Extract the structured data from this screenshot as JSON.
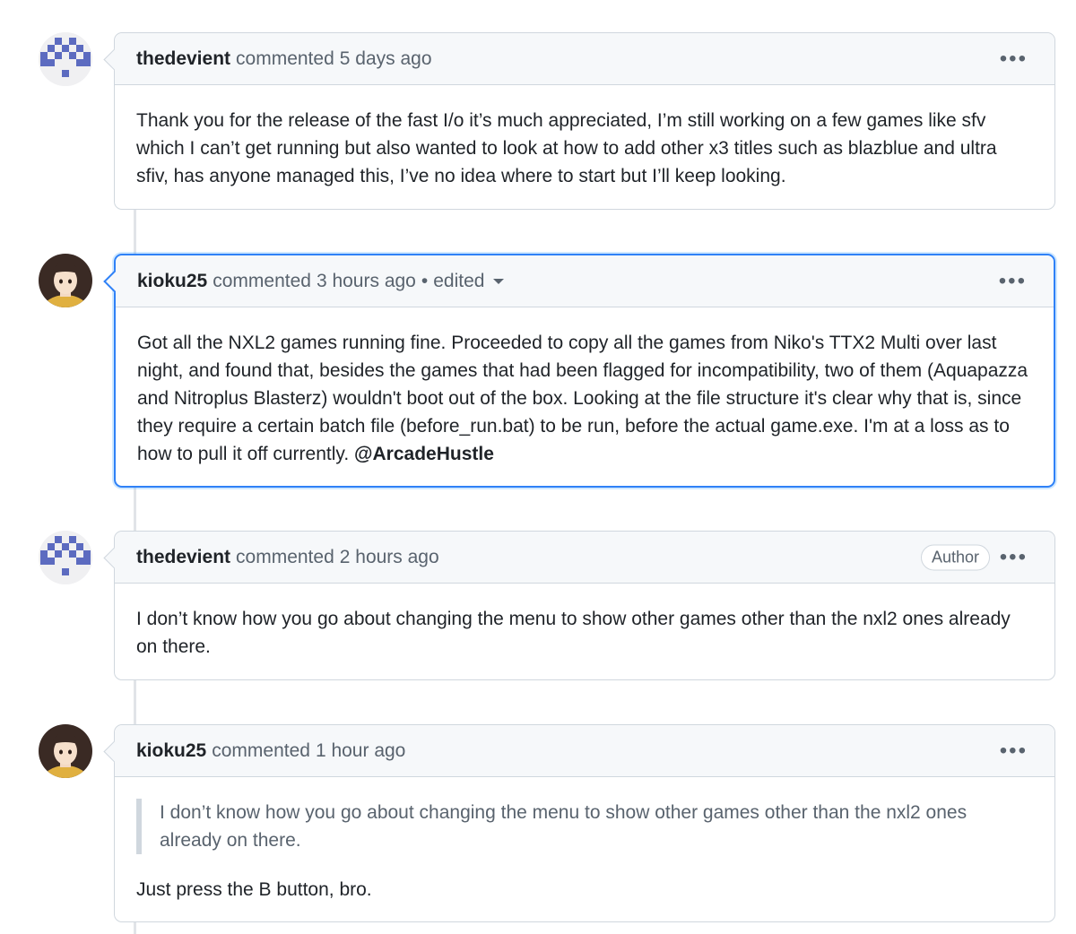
{
  "comments": [
    {
      "author": "thedevient",
      "action": "commented",
      "time": "5 days ago",
      "avatar": "identicon",
      "body": "Thank you for the release of the fast I/o it’s much appreciated, I’m still working on a few games like sfv which I can’t get running but also wanted to look at how to add other x3 titles such as blazblue and ultra sfiv, has anyone managed this, I’ve no idea where to start but I’ll keep looking."
    },
    {
      "author": "kioku25",
      "action": "commented",
      "time": "3 hours ago",
      "separator": "•",
      "edited": "edited",
      "avatar": "anime-girl",
      "body": "Got all the NXL2 games running fine. Proceeded to copy all the games from Niko's TTX2 Multi over last night, and found that, besides the games that had been flagged for incompatibility, two of them (Aquapazza and Nitroplus Blasterz) wouldn't boot out of the box. Looking at the file structure it's clear why that is, since they require a certain batch file (before_run.bat) to be run, before the actual game.exe. I'm at a loss as to how to pull it off currently.",
      "mention": "@ArcadeHustle"
    },
    {
      "author": "thedevient",
      "action": "commented",
      "time": "2 hours ago",
      "badge": "Author",
      "avatar": "identicon",
      "body": "I don’t know how you go about changing the menu to show other games other than the nxl2 ones already on there."
    },
    {
      "author": "kioku25",
      "action": "commented",
      "time": "1 hour ago",
      "avatar": "anime-girl",
      "quote": "I don’t know how you go about changing the menu to show other games other than the nxl2 ones already on there.",
      "body": "Just press the B button, bro."
    }
  ],
  "menu_icon": "kebab-horizontal-icon",
  "colors": {
    "identicon": "#5c6bc0",
    "highlight_border": "#2f81f7",
    "header_bg": "#f6f8fa",
    "border": "#d0d7de",
    "muted_text": "#59636e"
  }
}
